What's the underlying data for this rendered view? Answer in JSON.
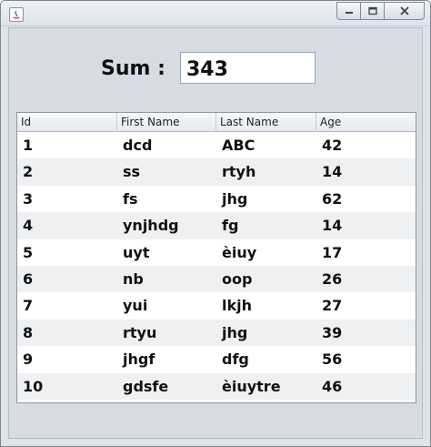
{
  "window": {
    "icon": "java-app-icon",
    "controls": [
      "minimize-icon",
      "maximize-icon",
      "close-icon"
    ]
  },
  "sum": {
    "label": "Sum :",
    "value": "343"
  },
  "table": {
    "columns": [
      "Id",
      "First Name",
      "Last Name",
      "Age"
    ],
    "rows": [
      [
        "1",
        "dcd",
        "ABC",
        "42"
      ],
      [
        "2",
        "ss",
        "rtyh",
        "14"
      ],
      [
        "3",
        "fs",
        "jhg",
        "62"
      ],
      [
        "4",
        "ynjhdg",
        "fg",
        "14"
      ],
      [
        "5",
        "uyt",
        "èiuy",
        "17"
      ],
      [
        "6",
        "nb",
        "oop",
        "26"
      ],
      [
        "7",
        "yui",
        "lkjh",
        "27"
      ],
      [
        "8",
        "rtyu",
        "jhg",
        "39"
      ],
      [
        "9",
        "jhgf",
        "dfg",
        "56"
      ],
      [
        "10",
        "gdsfe",
        "èiuytre",
        "46"
      ]
    ]
  }
}
